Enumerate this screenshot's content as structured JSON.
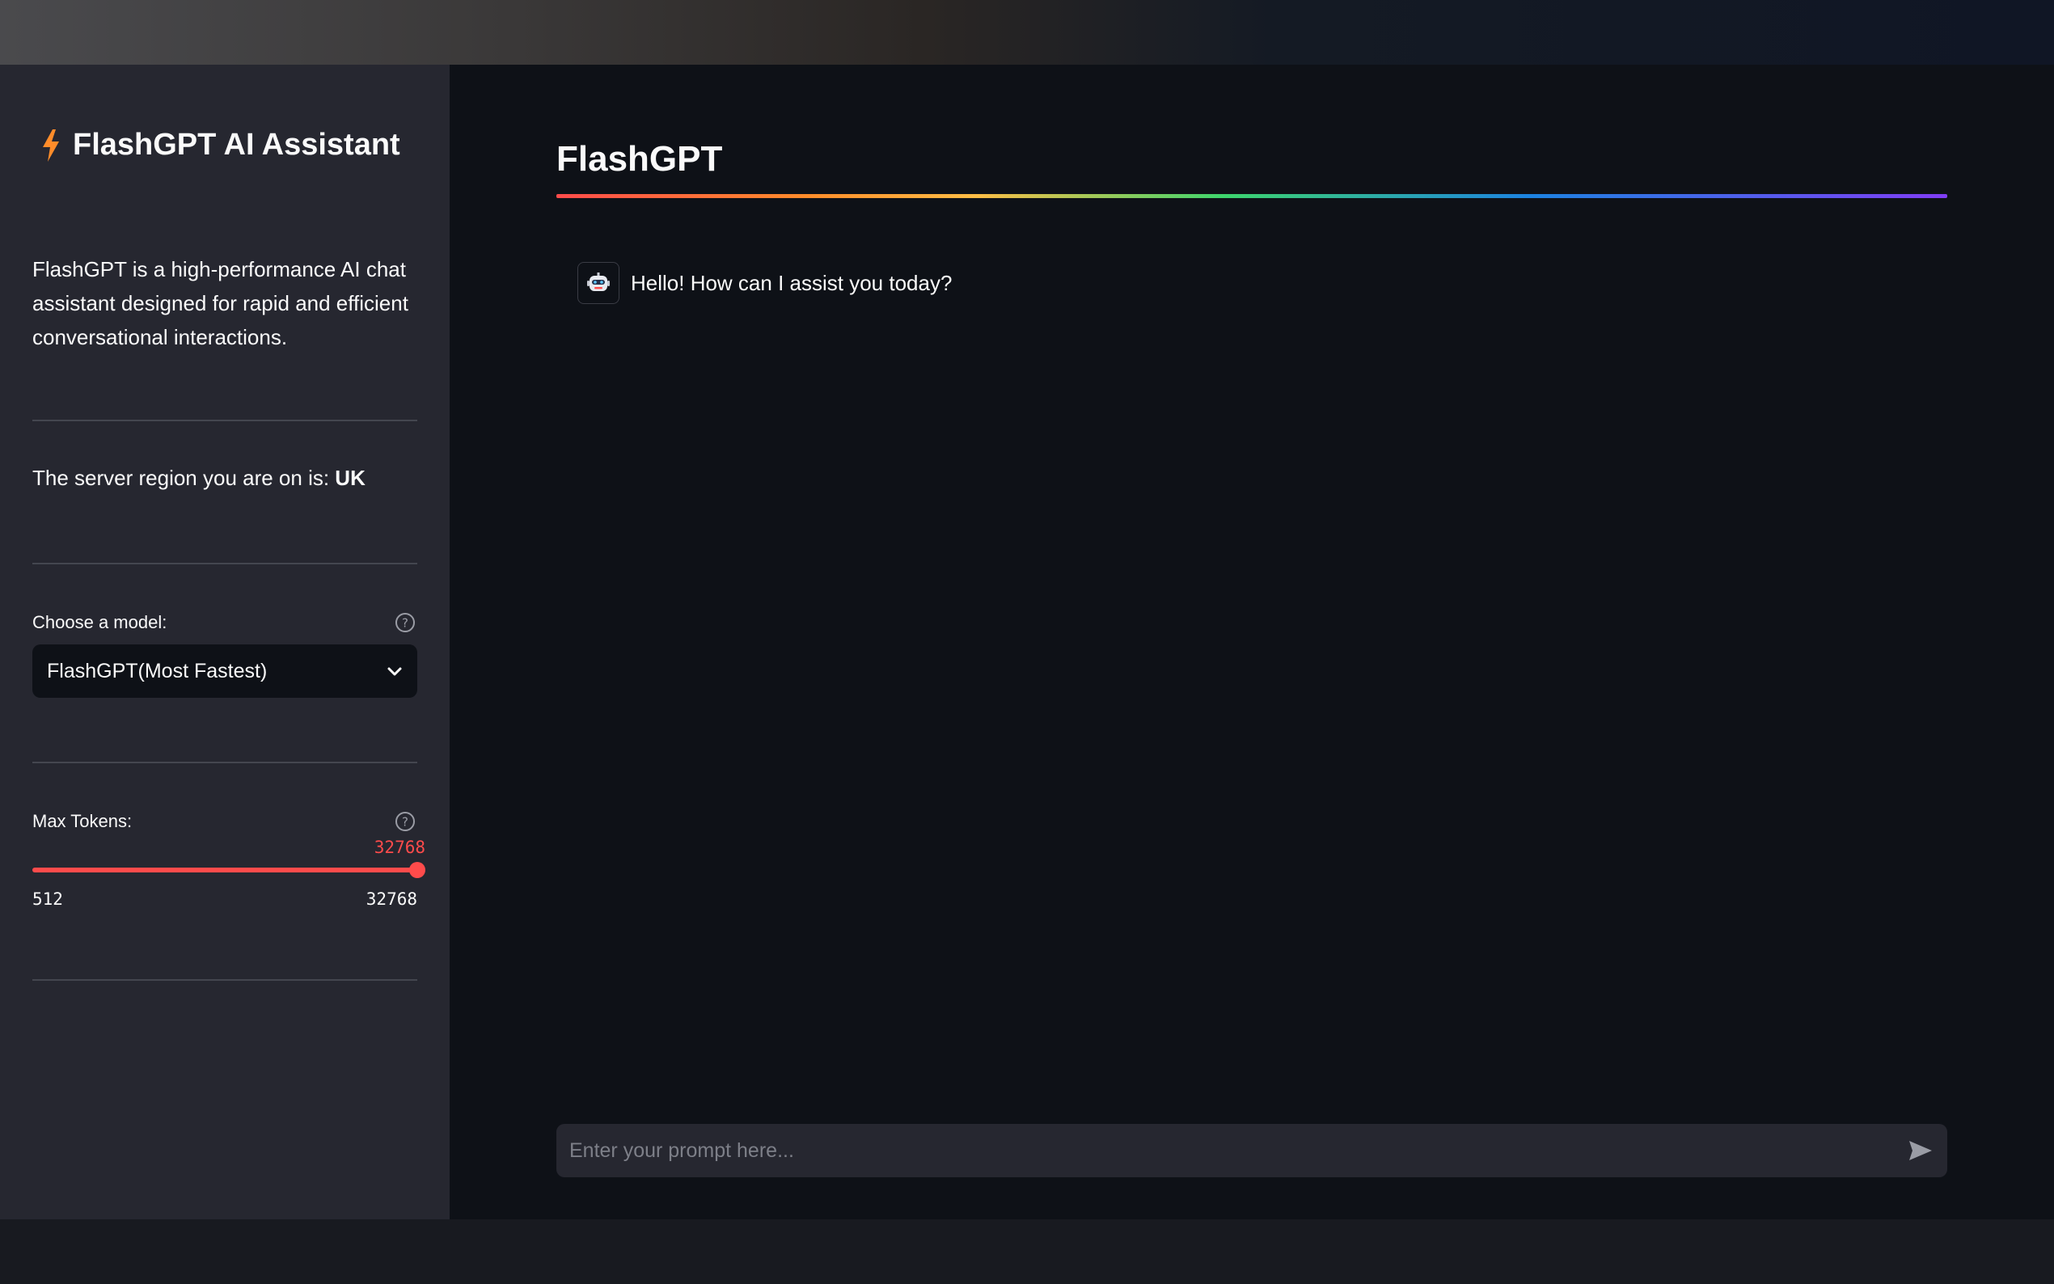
{
  "sidebar": {
    "title": "FlashGPT AI Assistant",
    "title_icon": "lightning-icon",
    "description": "FlashGPT is a high-performance AI chat assistant designed for rapid and efficient conversational interactions.",
    "region_label": "The server region you are on is: ",
    "region_value": "UK",
    "model_label": "Choose a model:",
    "model_selected": "FlashGPT(Most Fastest)",
    "tokens_label": "Max Tokens:",
    "tokens_value": "32768",
    "tokens_min": "512",
    "tokens_max": "32768",
    "tokens_fraction": 1.0
  },
  "main": {
    "title": "FlashGPT",
    "messages": [
      {
        "role": "assistant",
        "avatar": "robot-icon",
        "text": "Hello! How can I assist you today?"
      }
    ],
    "input_placeholder": "Enter your prompt here..."
  },
  "colors": {
    "accent": "#ff4b4b",
    "sidebar_bg": "#262730",
    "main_bg": "#0e1117",
    "lightning": "#ff8c2a"
  }
}
